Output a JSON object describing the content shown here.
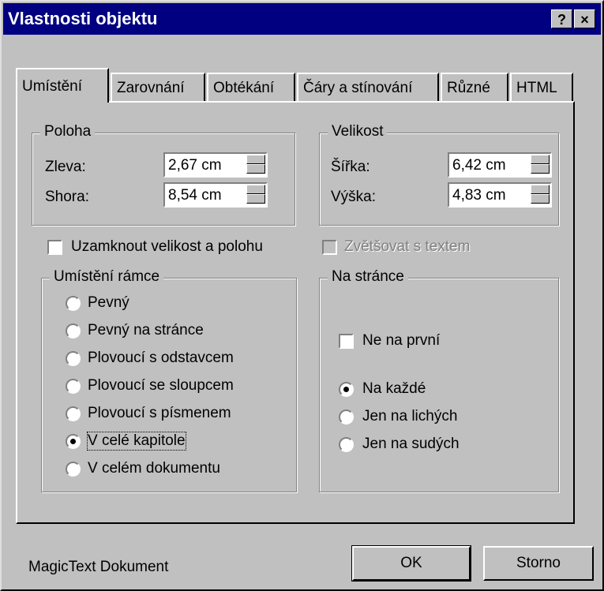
{
  "window": {
    "title": "Vlastnosti objektu",
    "help_button": "?",
    "close_button": "×"
  },
  "tabs": [
    {
      "label": "Umístění",
      "active": true
    },
    {
      "label": "Zarovnání",
      "active": false
    },
    {
      "label": "Obtékání",
      "active": false
    },
    {
      "label": "Čáry a stínování",
      "active": false
    },
    {
      "label": "Různé",
      "active": false
    },
    {
      "label": "HTML",
      "active": false
    }
  ],
  "poloha": {
    "title": "Poloha",
    "zleva_label": "Zleva:",
    "zleva_value": "2,67 cm",
    "shora_label": "Shora:",
    "shora_value": "8,54 cm"
  },
  "velikost": {
    "title": "Velikost",
    "sirka_label": "Šířka:",
    "sirka_value": "6,42 cm",
    "vyska_label": "Výška:",
    "vyska_value": "4,83 cm"
  },
  "checkboxes": {
    "lock_label": "Uzamknout velikost a polohu",
    "lock_checked": false,
    "grow_label": "Zvětšovat s textem",
    "grow_checked": false,
    "grow_enabled": false
  },
  "frame_position": {
    "title": "Umístění rámce",
    "options": [
      {
        "label": "Pevný",
        "selected": false
      },
      {
        "label": "Pevný na stránce",
        "selected": false
      },
      {
        "label": "Plovoucí s odstavcem",
        "selected": false
      },
      {
        "label": "Plovoucí se sloupcem",
        "selected": false
      },
      {
        "label": "Plovoucí s písmenem",
        "selected": false
      },
      {
        "label": "V celé kapitole",
        "selected": true
      },
      {
        "label": "V celém dokumentu",
        "selected": false
      }
    ]
  },
  "on_page": {
    "title": "Na stránce",
    "not_first_label": "Ne na první",
    "not_first_checked": false,
    "options": [
      {
        "label": "Na každé",
        "selected": true
      },
      {
        "label": "Jen na lichých",
        "selected": false
      },
      {
        "label": "Jen na sudých",
        "selected": false
      }
    ]
  },
  "footer": {
    "status_text": "MagicText Dokument",
    "ok_label": "OK",
    "cancel_label": "Storno"
  }
}
